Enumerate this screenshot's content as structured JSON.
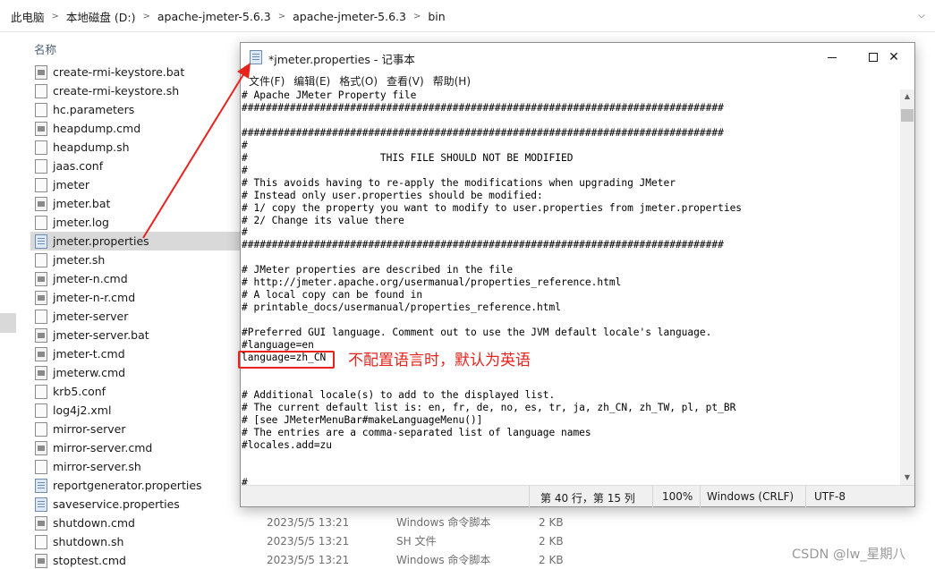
{
  "address_bar": {
    "crumbs": [
      "此电脑",
      "本地磁盘 (D:)",
      "apache-jmeter-5.6.3",
      "apache-jmeter-5.6.3",
      "bin"
    ]
  },
  "file_list": {
    "column_name": "名称",
    "files": [
      {
        "name": "create-rmi-keystore.bat",
        "icon": "cmd-file-icon"
      },
      {
        "name": "create-rmi-keystore.sh",
        "icon": "file-icon"
      },
      {
        "name": "hc.parameters",
        "icon": "file-icon"
      },
      {
        "name": "heapdump.cmd",
        "icon": "cmd-file-icon"
      },
      {
        "name": "heapdump.sh",
        "icon": "file-icon"
      },
      {
        "name": "jaas.conf",
        "icon": "file-icon"
      },
      {
        "name": "jmeter",
        "icon": "file-icon"
      },
      {
        "name": "jmeter.bat",
        "icon": "cmd-file-icon"
      },
      {
        "name": "jmeter.log",
        "icon": "file-icon"
      },
      {
        "name": "jmeter.properties",
        "icon": "properties-file-icon",
        "selected": true
      },
      {
        "name": "jmeter.sh",
        "icon": "file-icon"
      },
      {
        "name": "jmeter-n.cmd",
        "icon": "cmd-file-icon"
      },
      {
        "name": "jmeter-n-r.cmd",
        "icon": "cmd-file-icon"
      },
      {
        "name": "jmeter-server",
        "icon": "file-icon"
      },
      {
        "name": "jmeter-server.bat",
        "icon": "cmd-file-icon"
      },
      {
        "name": "jmeter-t.cmd",
        "icon": "cmd-file-icon"
      },
      {
        "name": "jmeterw.cmd",
        "icon": "cmd-file-icon"
      },
      {
        "name": "krb5.conf",
        "icon": "file-icon"
      },
      {
        "name": "log4j2.xml",
        "icon": "file-icon"
      },
      {
        "name": "mirror-server",
        "icon": "file-icon"
      },
      {
        "name": "mirror-server.cmd",
        "icon": "cmd-file-icon"
      },
      {
        "name": "mirror-server.sh",
        "icon": "file-icon"
      },
      {
        "name": "reportgenerator.properties",
        "icon": "properties-file-icon"
      },
      {
        "name": "saveservice.properties",
        "icon": "properties-file-icon"
      },
      {
        "name": "shutdown.cmd",
        "icon": "cmd-file-icon"
      },
      {
        "name": "shutdown.sh",
        "icon": "file-icon"
      },
      {
        "name": "stoptest.cmd",
        "icon": "cmd-file-icon"
      }
    ],
    "details": [
      {
        "date": "2023/5/5 13:21",
        "type": "Windows 命令脚本",
        "size": "2 KB"
      },
      {
        "date": "2023/5/5 13:21",
        "type": "SH 文件",
        "size": "2 KB"
      },
      {
        "date": "2023/5/5 13:21",
        "type": "Windows 命令脚本",
        "size": "2 KB"
      }
    ]
  },
  "notepad": {
    "title": "*jmeter.properties - 记事本",
    "menu": [
      "文件(F)",
      "编辑(E)",
      "格式(O)",
      "查看(V)",
      "帮助(H)"
    ],
    "content_lines": [
      "# Apache JMeter Property file",
      "################################################################################",
      "",
      "################################################################################",
      "#",
      "#                      THIS FILE SHOULD NOT BE MODIFIED",
      "#",
      "# This avoids having to re-apply the modifications when upgrading JMeter",
      "# Instead only user.properties should be modified:",
      "# 1/ copy the property you want to modify to user.properties from jmeter.properties",
      "# 2/ Change its value there",
      "#",
      "################################################################################",
      "",
      "# JMeter properties are described in the file",
      "# http://jmeter.apache.org/usermanual/properties_reference.html",
      "# A local copy can be found in",
      "# printable_docs/usermanual/properties_reference.html",
      "",
      "#Preferred GUI language. Comment out to use the JVM default locale's language.",
      "#language=en",
      "language=zh_CN",
      "",
      "",
      "# Additional locale(s) to add to the displayed list.",
      "# The current default list is: en, fr, de, no, es, tr, ja, zh_CN, zh_TW, pl, pt_BR",
      "# [see JMeterMenuBar#makeLanguageMenu()]",
      "# The entries are a comma-separated list of language names",
      "#locales.add=zu",
      "",
      "",
      "#___________________________________________________________________________"
    ],
    "status": {
      "position": "第 40 行，第 15 列",
      "zoom": "100%",
      "line_ending": "Windows (CRLF)",
      "encoding": "UTF-8"
    }
  },
  "annotation": {
    "label": "不配置语言时，默认为英语",
    "color": "#e8231d"
  },
  "watermark": "CSDN @lw_星期八"
}
